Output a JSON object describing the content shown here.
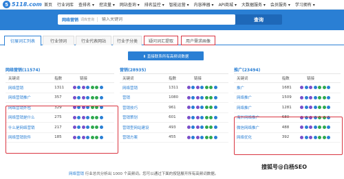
{
  "logo": {
    "text": "5118.com"
  },
  "nav": {
    "items": [
      "首页",
      "行业词库",
      "查排名 ▾",
      "挖流量 ▾",
      "网站查询 ▾",
      "排名监控 ▾",
      "智能运营 ▾",
      "内容神器 ▾",
      "API商城 ▾",
      "大数据服务 ▾",
      "会员服务 ▾",
      "学习拥有 ▾"
    ]
  },
  "search": {
    "tag": "网络营销",
    "sub": "词库查询",
    "placeholder": "输入关键词",
    "button": "查询"
  },
  "tabs": [
    "衍展词汇列表",
    "行业领词",
    "行业代表网站",
    "行业子分类",
    "疑问词汇提取",
    "用户需求画像"
  ],
  "download_button": "⬇ 直接联系所有高频词数据",
  "panels": [
    {
      "title": "网络营销(11574)",
      "header": {
        "kw": "关键词",
        "num": "指数",
        "link": "链接"
      },
      "rows": [
        {
          "kw": "网络营销",
          "num": "1311"
        },
        {
          "kw": "网络营销推广",
          "num": "357"
        },
        {
          "kw": "网络营销外包",
          "num": "329"
        },
        {
          "kw": "网络营销是什么",
          "num": "275"
        },
        {
          "kw": "什么是网络营销",
          "num": "217"
        },
        {
          "kw": "网络营销软件",
          "num": "185"
        }
      ]
    },
    {
      "title": "营销(28935)",
      "header": {
        "kw": "关键词",
        "num": "指数",
        "link": "链接"
      },
      "rows": [
        {
          "kw": "网络营销",
          "num": "1311"
        },
        {
          "kw": "营销",
          "num": "1080"
        },
        {
          "kw": "营销技巧",
          "num": "961"
        },
        {
          "kw": "营销策划",
          "num": "601"
        },
        {
          "kw": "营销型网站建设",
          "num": "493"
        },
        {
          "kw": "营销方案",
          "num": "455"
        }
      ]
    },
    {
      "title": "推广(23494)",
      "header": {
        "kw": "关键词",
        "num": "指数",
        "link": "链接"
      },
      "rows": [
        {
          "kw": "推广",
          "num": "1681"
        },
        {
          "kw": "网络推广",
          "num": "1509"
        },
        {
          "kw": "网络推广",
          "num": "1281"
        },
        {
          "kw": "海外网络推广",
          "num": "680"
        },
        {
          "kw": "微信网络推广",
          "num": "488"
        },
        {
          "kw": "网络优化",
          "num": "392"
        }
      ]
    }
  ],
  "footer": {
    "pre": "网络营销",
    "text": "行业总共分析出 1000 个高频词。您可以通过下面的按钮展开所有高频词数据。"
  },
  "watermark": "搜狐号@白杨SEO",
  "colors": {
    "brand": "#2a7fd4",
    "highlight": "#d9333f"
  }
}
